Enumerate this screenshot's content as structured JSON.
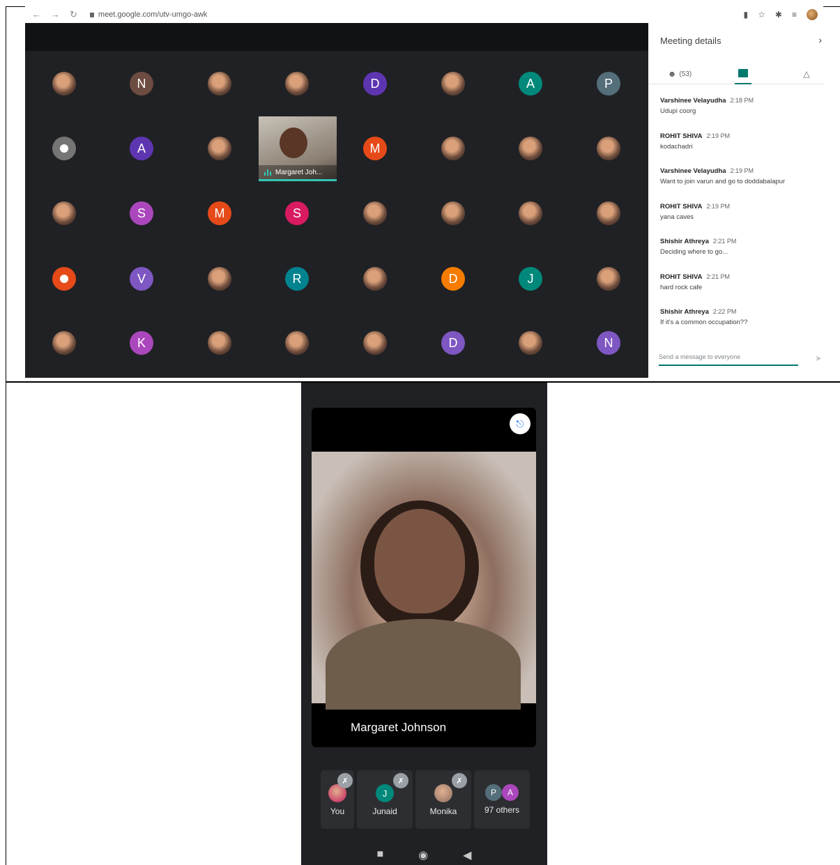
{
  "browser": {
    "url": "meet.google.com/utv-umgo-awk"
  },
  "grid": {
    "rows": [
      [
        {
          "type": "photo"
        },
        {
          "type": "letter",
          "letter": "N",
          "color": "#6d4c41"
        },
        {
          "type": "photo"
        },
        {
          "type": "photo"
        },
        {
          "type": "letter",
          "letter": "D",
          "color": "#5e35b1"
        },
        {
          "type": "photo"
        },
        {
          "type": "letter",
          "letter": "A",
          "color": "#00897b"
        },
        {
          "type": "letter",
          "letter": "P",
          "color": "#546e7a"
        }
      ],
      [
        {
          "type": "letter",
          "letter": "",
          "color": "#757575"
        },
        {
          "type": "letter",
          "letter": "A",
          "color": "#5e35b1"
        },
        {
          "type": "photo"
        },
        {
          "type": "tile"
        },
        {
          "type": "letter",
          "letter": "M",
          "color": "#e64a19"
        },
        {
          "type": "photo"
        },
        {
          "type": "photo"
        },
        {
          "type": "photo"
        }
      ],
      [
        {
          "type": "photo"
        },
        {
          "type": "letter",
          "letter": "S",
          "color": "#ab47bc"
        },
        {
          "type": "letter",
          "letter": "M",
          "color": "#e64a19"
        },
        {
          "type": "letter",
          "letter": "S",
          "color": "#d81b60"
        },
        {
          "type": "photo"
        },
        {
          "type": "photo"
        },
        {
          "type": "photo"
        },
        {
          "type": "photo"
        }
      ],
      [
        {
          "type": "letter",
          "letter": "",
          "color": "#e64a19"
        },
        {
          "type": "letter",
          "letter": "V",
          "color": "#7e57c2"
        },
        {
          "type": "photo"
        },
        {
          "type": "letter",
          "letter": "R",
          "color": "#00838f"
        },
        {
          "type": "photo"
        },
        {
          "type": "letter",
          "letter": "D",
          "color": "#f57c00"
        },
        {
          "type": "letter",
          "letter": "J",
          "color": "#00897b"
        },
        {
          "type": "photo"
        }
      ],
      [
        {
          "type": "photo"
        },
        {
          "type": "letter",
          "letter": "K",
          "color": "#ab47bc"
        },
        {
          "type": "photo"
        },
        {
          "type": "photo"
        },
        {
          "type": "photo"
        },
        {
          "type": "letter",
          "letter": "D",
          "color": "#7e57c2"
        },
        {
          "type": "photo"
        },
        {
          "type": "letter",
          "letter": "N",
          "color": "#7e57c2"
        }
      ]
    ],
    "tile_name": "Margaret Joh..."
  },
  "panel": {
    "title": "Meeting details",
    "people_count": "(53)",
    "messages": [
      {
        "sender": "Varshinee Velayudha",
        "time": "2:18 PM",
        "text": "Udupi coorg"
      },
      {
        "sender": "ROHIT SHIVA",
        "time": "2:19 PM",
        "text": "kodachadri"
      },
      {
        "sender": "Varshinee Velayudha",
        "time": "2:19 PM",
        "text": "Want to join varun and go to doddabalapur"
      },
      {
        "sender": "ROHIT SHIVA",
        "time": "2:19 PM",
        "text": "yana caves"
      },
      {
        "sender": "Shishir Athreya",
        "time": "2:21 PM",
        "text": "Deciding where to go..."
      },
      {
        "sender": "ROHIT SHIVA",
        "time": "2:21 PM",
        "text": "hard rock cafe"
      },
      {
        "sender": "Shishir Athreya",
        "time": "2:22 PM",
        "text": "If it's a common occupation??"
      }
    ],
    "compose_placeholder": "Send a message to everyone"
  },
  "phone": {
    "pinned_name": "Margaret Johnson",
    "participants": [
      {
        "label": "You",
        "initial": "",
        "color": "#c2185b"
      },
      {
        "label": "Junaid",
        "initial": "J",
        "color": "#00897b"
      },
      {
        "label": "Monika",
        "initial": "",
        "color": "#8d6e63"
      },
      {
        "label": "97 others",
        "initials": [
          "P",
          "A"
        ],
        "colors": [
          "#546e7a",
          "#ab47bc"
        ]
      }
    ],
    "icons": {
      "pin": "pin-icon",
      "mute": "mic-off-icon",
      "nav": [
        "square-icon",
        "circle-icon",
        "back-icon"
      ]
    }
  }
}
